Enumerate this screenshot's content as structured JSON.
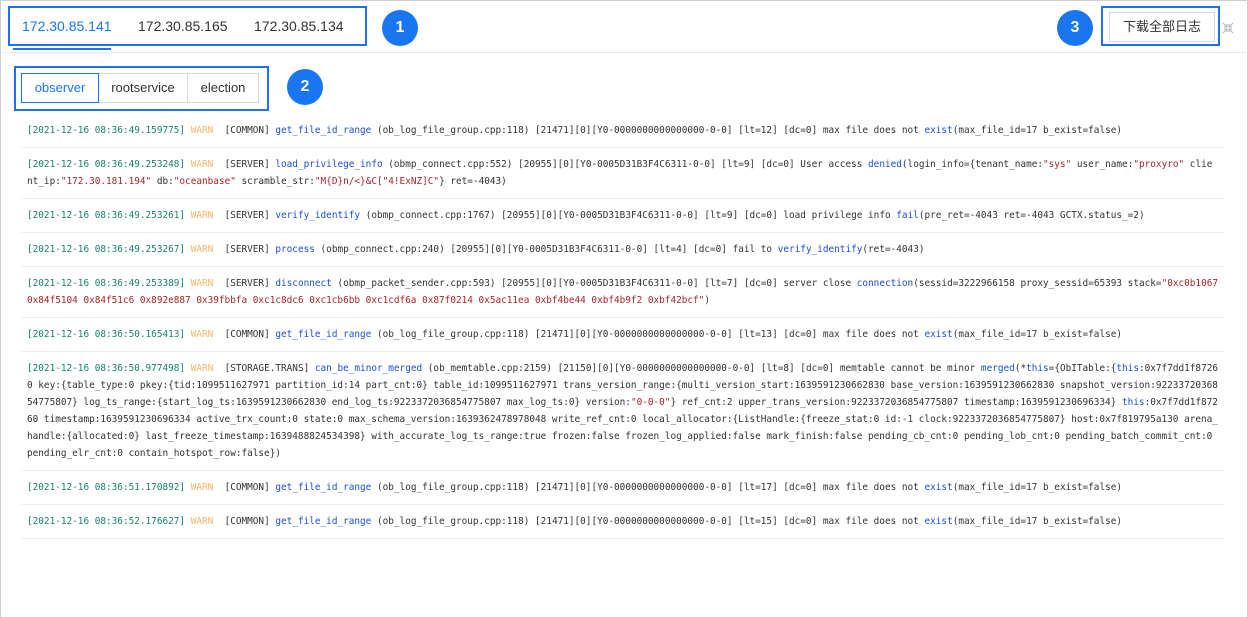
{
  "hosts": {
    "tabs": [
      "172.30.85.141",
      "172.30.85.165",
      "172.30.85.134"
    ],
    "active_index": 0
  },
  "download_label": "下载全部日志",
  "callouts": [
    "1",
    "2",
    "3"
  ],
  "modules": {
    "items": [
      "observer",
      "rootservice",
      "election"
    ],
    "active_index": 0
  },
  "logs": [
    {
      "ts": "[2021-12-16 08:36:49.159775]",
      "level": "WARN",
      "segments": [
        {
          "t": "  [COMMON] "
        },
        {
          "t": "get_file_id_range",
          "c": "fn"
        },
        {
          "t": " (ob_log_file_group.cpp:118) [21471][0][Y0-0000000000000000-0-0] [lt=12] [dc=0] max file does not "
        },
        {
          "t": "exist",
          "c": "fn"
        },
        {
          "t": "(max_file_id=17 b_exist=false)"
        }
      ]
    },
    {
      "ts": "[2021-12-16 08:36:49.253248]",
      "level": "WARN",
      "segments": [
        {
          "t": "  [SERVER] "
        },
        {
          "t": "load_privilege_info",
          "c": "fn"
        },
        {
          "t": " (obmp_connect.cpp:552) [20955][0][Y0-0005D31B3F4C6311-0-0] [lt=9] [dc=0] User access "
        },
        {
          "t": "denied",
          "c": "fn"
        },
        {
          "t": "(login_info={tenant_name:"
        },
        {
          "t": "\"sys\"",
          "c": "str"
        },
        {
          "t": " user_name:"
        },
        {
          "t": "\"proxyro\"",
          "c": "str"
        },
        {
          "t": " client_ip:"
        },
        {
          "t": "\"172.30.181.194\"",
          "c": "str"
        },
        {
          "t": " db:"
        },
        {
          "t": "\"oceanbase\"",
          "c": "str"
        },
        {
          "t": " scramble_str:"
        },
        {
          "t": "\"M{D}n/<}&C[\"4!ExNZ]C\"",
          "c": "str"
        },
        {
          "t": "} ret=-4043)"
        }
      ]
    },
    {
      "ts": "[2021-12-16 08:36:49.253261]",
      "level": "WARN",
      "segments": [
        {
          "t": "  [SERVER] "
        },
        {
          "t": "verify_identify",
          "c": "fn"
        },
        {
          "t": " (obmp_connect.cpp:1767) [20955][0][Y0-0005D31B3F4C6311-0-0] [lt=9] [dc=0] load privilege info "
        },
        {
          "t": "fail",
          "c": "fn"
        },
        {
          "t": "(pre_ret=-4043 ret=-4043 GCTX.status_=2)"
        }
      ]
    },
    {
      "ts": "[2021-12-16 08:36:49.253267]",
      "level": "WARN",
      "segments": [
        {
          "t": "  [SERVER] "
        },
        {
          "t": "process",
          "c": "fn"
        },
        {
          "t": " (obmp_connect.cpp:240) [20955][0][Y0-0005D31B3F4C6311-0-0] [lt=4] [dc=0] fail to "
        },
        {
          "t": "verify_identify",
          "c": "fn"
        },
        {
          "t": "(ret=-4043)"
        }
      ]
    },
    {
      "ts": "[2021-12-16 08:36:49.253389]",
      "level": "WARN",
      "segments": [
        {
          "t": "  [SERVER] "
        },
        {
          "t": "disconnect",
          "c": "fn"
        },
        {
          "t": " (obmp_packet_sender.cpp:593) [20955][0][Y0-0005D31B3F4C6311-0-0] [lt=7] [dc=0] server close "
        },
        {
          "t": "connection",
          "c": "fn"
        },
        {
          "t": "(sessid=3222966158 proxy_sessid=65393 stack="
        },
        {
          "t": "\"0xc0b1067 0x84f5104 0x84f51c6 0x892e887 0x39fbbfa 0xc1c8dc6 0xc1cb6bb 0xc1cdf6a 0x87f0214 0x5ac11ea 0xbf4be44 0xbf4b9f2 0xbf42bcf\"",
          "c": "str"
        },
        {
          "t": ")"
        }
      ]
    },
    {
      "ts": "[2021-12-16 08:36:50.165413]",
      "level": "WARN",
      "segments": [
        {
          "t": "  [COMMON] "
        },
        {
          "t": "get_file_id_range",
          "c": "fn"
        },
        {
          "t": " (ob_log_file_group.cpp:118) [21471][0][Y0-0000000000000000-0-0] [lt=13] [dc=0] max file does not "
        },
        {
          "t": "exist",
          "c": "fn"
        },
        {
          "t": "(max_file_id=17 b_exist=false)"
        }
      ]
    },
    {
      "ts": "[2021-12-16 08:36:50.977498]",
      "level": "WARN",
      "segments": [
        {
          "t": "  [STORAGE.TRANS] "
        },
        {
          "t": "can_be_minor_merged",
          "c": "fn"
        },
        {
          "t": " (ob_memtable.cpp:2159) [21150][0][Y0-0000000000000000-0-0] [lt=8] [dc=0] memtable cannot be minor "
        },
        {
          "t": "merged",
          "c": "fn"
        },
        {
          "t": "(*"
        },
        {
          "t": "this",
          "c": "fn"
        },
        {
          "t": "={ObITable:{"
        },
        {
          "t": "this",
          "c": "fn"
        },
        {
          "t": ":0x7f7dd1f87260 key:{table_type:0 pkey:{tid:1099511627971 partition_id:14 part_cnt:0} table_id:1099511627971 trans_version_range:{multi_version_start:1639591230662830 base_version:1639591230662830 snapshot_version:9223372036854775807} log_ts_range:{start_log_ts:1639591230662830 end_log_ts:9223372036854775807 max_log_ts:0} version:"
        },
        {
          "t": "\"0-0-0\"",
          "c": "str"
        },
        {
          "t": "} ref_cnt:2 upper_trans_version:9223372036854775807 timestamp:1639591230696334} "
        },
        {
          "t": "this",
          "c": "fn"
        },
        {
          "t": ":0x7f7dd1f87260 timestamp:1639591230696334 active_trx_count:0 state:0 max_schema_version:1639362478978048 write_ref_cnt:0 local_allocator:{ListHandle:{freeze_stat:0 id:-1 clock:9223372036854775807} host:0x7f819795a130 arena_handle:{allocated:0} last_freeze_timestamp:1639488824534398} with_accurate_log_ts_range:true frozen:false frozen_log_applied:false mark_finish:false pending_cb_cnt:0 pending_lob_cnt:0 pending_batch_commit_cnt:0 pending_elr_cnt:0 contain_hotspot_row:false})"
        }
      ]
    },
    {
      "ts": "[2021-12-16 08:36:51.170892]",
      "level": "WARN",
      "segments": [
        {
          "t": "  [COMMON] "
        },
        {
          "t": "get_file_id_range",
          "c": "fn"
        },
        {
          "t": " (ob_log_file_group.cpp:118) [21471][0][Y0-0000000000000000-0-0] [lt=17] [dc=0] max file does not "
        },
        {
          "t": "exist",
          "c": "fn"
        },
        {
          "t": "(max_file_id=17 b_exist=false)"
        }
      ]
    },
    {
      "ts": "[2021-12-16 08:36:52.176627]",
      "level": "WARN",
      "segments": [
        {
          "t": "  [COMMON] "
        },
        {
          "t": "get_file_id_range",
          "c": "fn"
        },
        {
          "t": " (ob_log_file_group.cpp:118) [21471][0][Y0-0000000000000000-0-0] [lt=15] [dc=0] max file does not "
        },
        {
          "t": "exist",
          "c": "fn"
        },
        {
          "t": "(max_file_id=17 b_exist=false)"
        }
      ]
    }
  ]
}
